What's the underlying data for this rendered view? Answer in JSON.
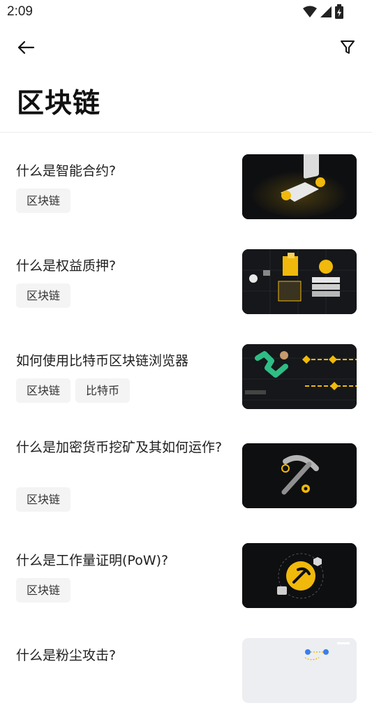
{
  "status_bar": {
    "time": "2:09"
  },
  "app_bar": {
    "back_icon": "arrow-left-icon",
    "filter_icon": "filter-icon"
  },
  "page": {
    "title": "区块链"
  },
  "articles": [
    {
      "title": "什么是智能合约?",
      "tags": [
        "区块链"
      ],
      "thumbnail": "smart-contract-illustration"
    },
    {
      "title": "什么是权益质押?",
      "tags": [
        "区块链"
      ],
      "thumbnail": "staking-illustration"
    },
    {
      "title": "如何使用比特币区块链浏览器",
      "tags": [
        "区块链",
        "比特币"
      ],
      "thumbnail": "block-explorer-illustration"
    },
    {
      "title": "什么是加密货币挖矿及其如何运作?",
      "tags": [
        "区块链"
      ],
      "thumbnail": "mining-illustration"
    },
    {
      "title": "什么是工作量证明(PoW)?",
      "tags": [
        "区块链"
      ],
      "thumbnail": "proof-of-work-illustration"
    },
    {
      "title": "什么是粉尘攻击?",
      "tags": [],
      "thumbnail": "dusting-attack-illustration"
    }
  ],
  "colors": {
    "accent": "#f0b90b",
    "thumb_bg": "#0e0f11",
    "tag_bg": "#f4f4f4"
  }
}
